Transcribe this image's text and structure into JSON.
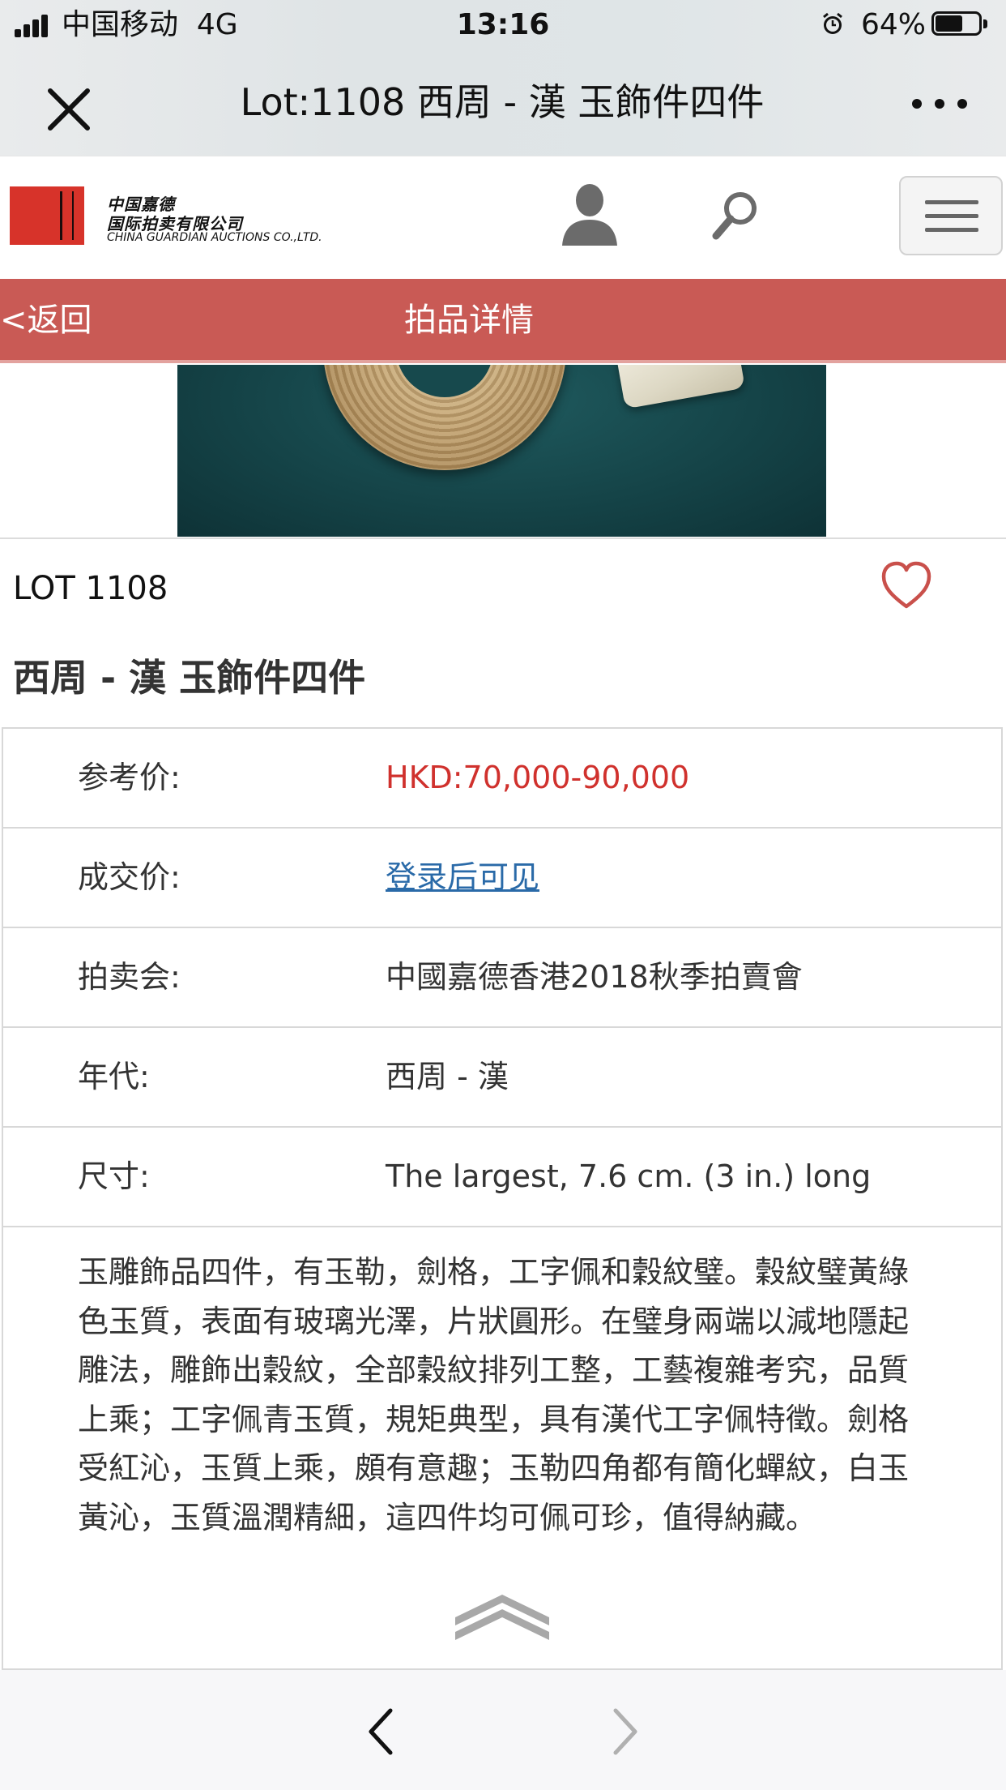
{
  "status_bar": {
    "carrier": "中国移动",
    "network": "4G",
    "time": "13:16",
    "battery_percent": "64%",
    "battery_level": 0.64
  },
  "wechat_bar": {
    "title": "Lot:1108 西周 - 漢 玉飾件四件",
    "close_icon": "close-icon",
    "more_icon": "more-dots-icon"
  },
  "site_header": {
    "logo_cn_line1": "中国嘉德",
    "logo_cn_line2": "国际拍卖有限公司",
    "logo_en": "CHINA GUARDIAN AUCTIONS CO.,LTD.",
    "icons": [
      "user-icon",
      "search-icon",
      "hamburger-menu-icon"
    ]
  },
  "nav_bar": {
    "back_label": "<返回",
    "title": "拍品详情"
  },
  "lot": {
    "number_label": "LOT 1108",
    "title": "西周 - 漢 玉飾件四件",
    "favorite_icon": "heart-icon"
  },
  "details": {
    "estimate_label": "参考价:",
    "estimate_value": "HKD:70,000-90,000",
    "hammer_label": "成交价:",
    "hammer_value": "登录后可见",
    "sale_label": "拍卖会:",
    "sale_value": "中國嘉德香港2018秋季拍賣會",
    "period_label": "年代:",
    "period_value": "西周 - 漢",
    "size_label": "尺寸:",
    "size_value": "The largest, 7.6 cm. (3 in.) long"
  },
  "description": "玉雕飾品四件，有玉勒，劍格，工字佩和穀紋璧。穀紋璧黃綠色玉質，表面有玻璃光澤，片狀圓形。在璧身兩端以減地隱起雕法，雕飾出穀紋，全部穀紋排列工整，工藝複雜考究，品質上乘；工字佩青玉質，規矩典型，具有漢代工字佩特徵。劍格受紅沁，玉質上乘，頗有意趣；玉勒四角都有簡化蟬紋，白玉黃沁，玉質溫潤精細，這四件均可佩可珍，值得納藏。",
  "colors": {
    "nav_red": "#c95a55",
    "price_red": "#d0312d",
    "link_blue": "#2a6aa8",
    "logo_red": "#d7332a"
  },
  "bottom_bar": {
    "icons": [
      "chevron-left-icon",
      "chevron-right-icon"
    ]
  }
}
